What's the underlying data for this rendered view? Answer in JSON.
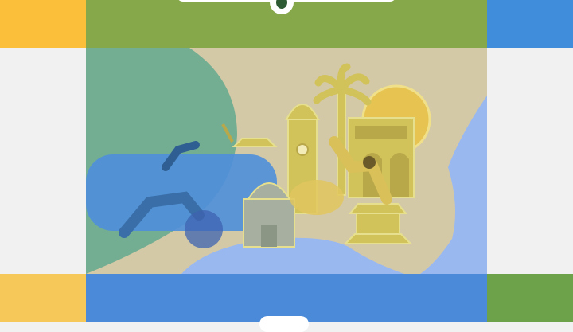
{
  "colors": {
    "yellow": "#fbbf3a",
    "yellow_light": "#f6c85a",
    "green": "#86a84a",
    "green_dark": "#6da24a",
    "blue": "#3f8ddb",
    "blue_bottom": "#4a8ad8",
    "light_gray": "#f1f1f1",
    "beige": "#d4c9a6",
    "teal": "#73ae93",
    "sky": "#9ab8f0",
    "mustard": "#d2c25a",
    "olive_line": "#e6e08e",
    "navy": "#3a6ea8",
    "dark_green": "#2e5b34"
  },
  "icons": {
    "top_indicator": "pill-with-dot-icon",
    "bottom_indicator": "pill-icon",
    "illustration": "culture-landmarks-illustration"
  }
}
